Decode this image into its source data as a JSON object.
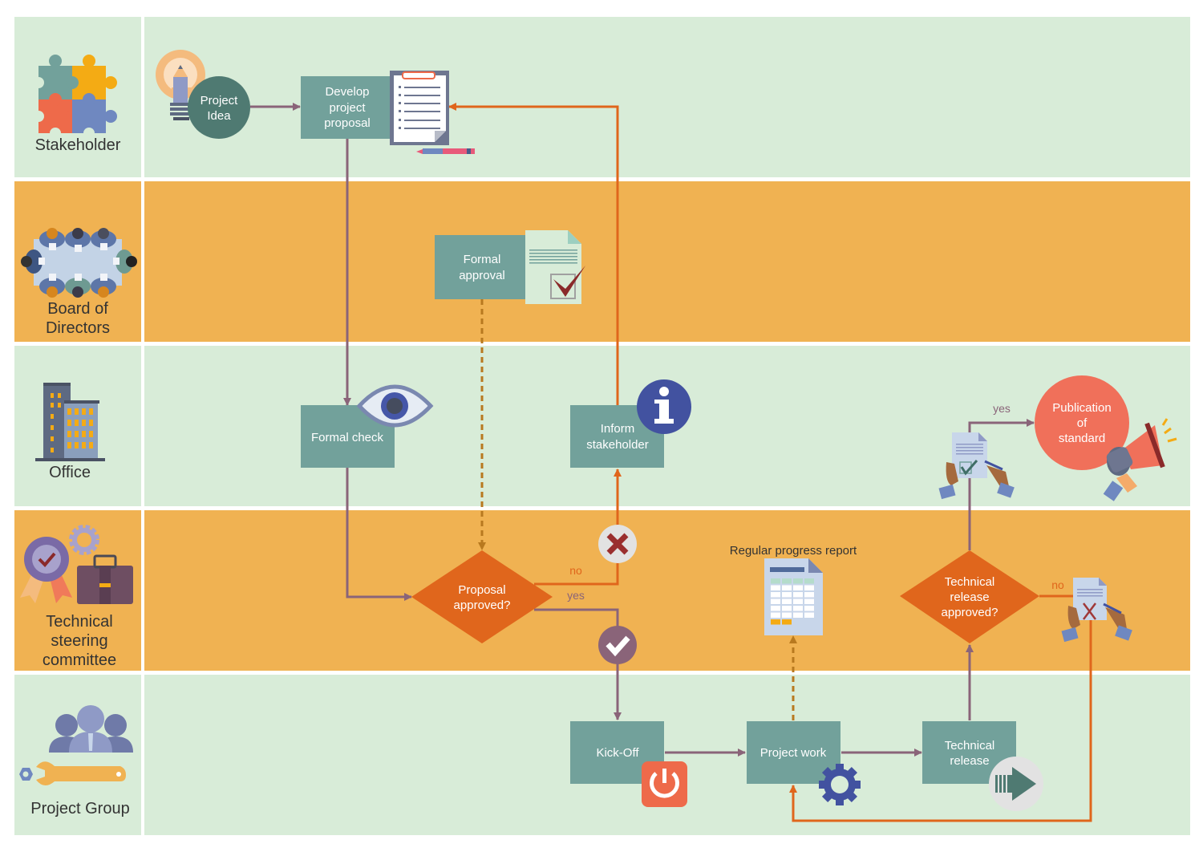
{
  "diagram": {
    "type": "swimlane-flowchart",
    "colors": {
      "lane_green": "#d8ecd8",
      "lane_orange": "#f0b252",
      "process_box": "#72a19b",
      "decision": "#e0661c",
      "circle_dark": "#4f7a72",
      "publication": "#f0705a",
      "flow_arrow": "#8a6479",
      "loop_arrow": "#e0661c",
      "data_arrow": "#b8791f",
      "no_label": "#e0661c",
      "yes_label": "#8a6479"
    },
    "lanes": [
      {
        "id": "stakeholder",
        "label_lines": [
          "Stakeholder"
        ],
        "icon": "puzzle-icon"
      },
      {
        "id": "board",
        "label_lines": [
          "Board of",
          "Directors"
        ],
        "icon": "meeting-table-icon"
      },
      {
        "id": "office",
        "label_lines": [
          "Office"
        ],
        "icon": "office-building-icon"
      },
      {
        "id": "steering",
        "label_lines": [
          "Technical",
          "steering",
          "committee"
        ],
        "icon": "award-briefcase-icon"
      },
      {
        "id": "group",
        "label_lines": [
          "Project Group"
        ],
        "icon": "team-wrench-icon"
      }
    ],
    "nodes": {
      "project_idea": {
        "lines": [
          "Project",
          "Idea"
        ],
        "shape": "circle",
        "lane": "stakeholder",
        "icon": "lightbulb-pencil-icon"
      },
      "develop_proposal": {
        "lines": [
          "Develop",
          "project",
          "proposal"
        ],
        "shape": "process",
        "lane": "stakeholder",
        "icon": "clipboard-icon"
      },
      "formal_approval": {
        "lines": [
          "Formal",
          "approval"
        ],
        "shape": "process",
        "lane": "board",
        "icon": "approved-document-icon"
      },
      "formal_check": {
        "lines": [
          "Formal check"
        ],
        "shape": "process",
        "lane": "office",
        "icon": "eye-icon"
      },
      "inform_stakeholder": {
        "lines": [
          "Inform",
          "stakeholder"
        ],
        "shape": "process",
        "lane": "office",
        "icon": "info-icon"
      },
      "publication": {
        "lines": [
          "Publication",
          "of",
          "standard"
        ],
        "shape": "circle",
        "lane": "office",
        "icon": "megaphone-icon"
      },
      "proposal_approved": {
        "lines": [
          "Proposal",
          "approved?"
        ],
        "shape": "decision",
        "lane": "steering"
      },
      "tech_release_approved": {
        "lines": [
          "Technical",
          "release",
          "approved?"
        ],
        "shape": "decision",
        "lane": "steering"
      },
      "kickoff": {
        "lines": [
          "Kick-Off"
        ],
        "shape": "process",
        "lane": "group",
        "icon": "power-icon"
      },
      "project_work": {
        "lines": [
          "Project work"
        ],
        "shape": "process",
        "lane": "group",
        "icon": "gear-icon"
      },
      "tech_release": {
        "lines": [
          "Technical",
          "release"
        ],
        "shape": "process",
        "lane": "group",
        "icon": "forward-arrow-icon"
      }
    },
    "annotations": {
      "progress_report": "Regular progress report"
    },
    "edges": [
      {
        "from": "project_idea",
        "to": "develop_proposal",
        "style": "solid"
      },
      {
        "from": "develop_proposal",
        "to": "formal_check",
        "style": "solid"
      },
      {
        "from": "formal_check",
        "to": "proposal_approved",
        "style": "solid"
      },
      {
        "from": "formal_approval",
        "to": "proposal_approved",
        "style": "dashed"
      },
      {
        "from": "proposal_approved",
        "to": "inform_stakeholder",
        "label": "no",
        "style": "solid"
      },
      {
        "from": "inform_stakeholder",
        "to": "develop_proposal",
        "style": "solid"
      },
      {
        "from": "proposal_approved",
        "to": "kickoff",
        "label": "yes",
        "style": "solid"
      },
      {
        "from": "kickoff",
        "to": "project_work",
        "style": "solid"
      },
      {
        "from": "project_work",
        "to": "progress_report",
        "style": "dashed"
      },
      {
        "from": "project_work",
        "to": "tech_release",
        "style": "solid"
      },
      {
        "from": "tech_release",
        "to": "tech_release_approved",
        "style": "solid"
      },
      {
        "from": "tech_release_approved",
        "to": "publication",
        "label": "yes",
        "style": "solid"
      },
      {
        "from": "tech_release_approved",
        "to": "project_work",
        "label": "no",
        "style": "solid"
      }
    ]
  }
}
